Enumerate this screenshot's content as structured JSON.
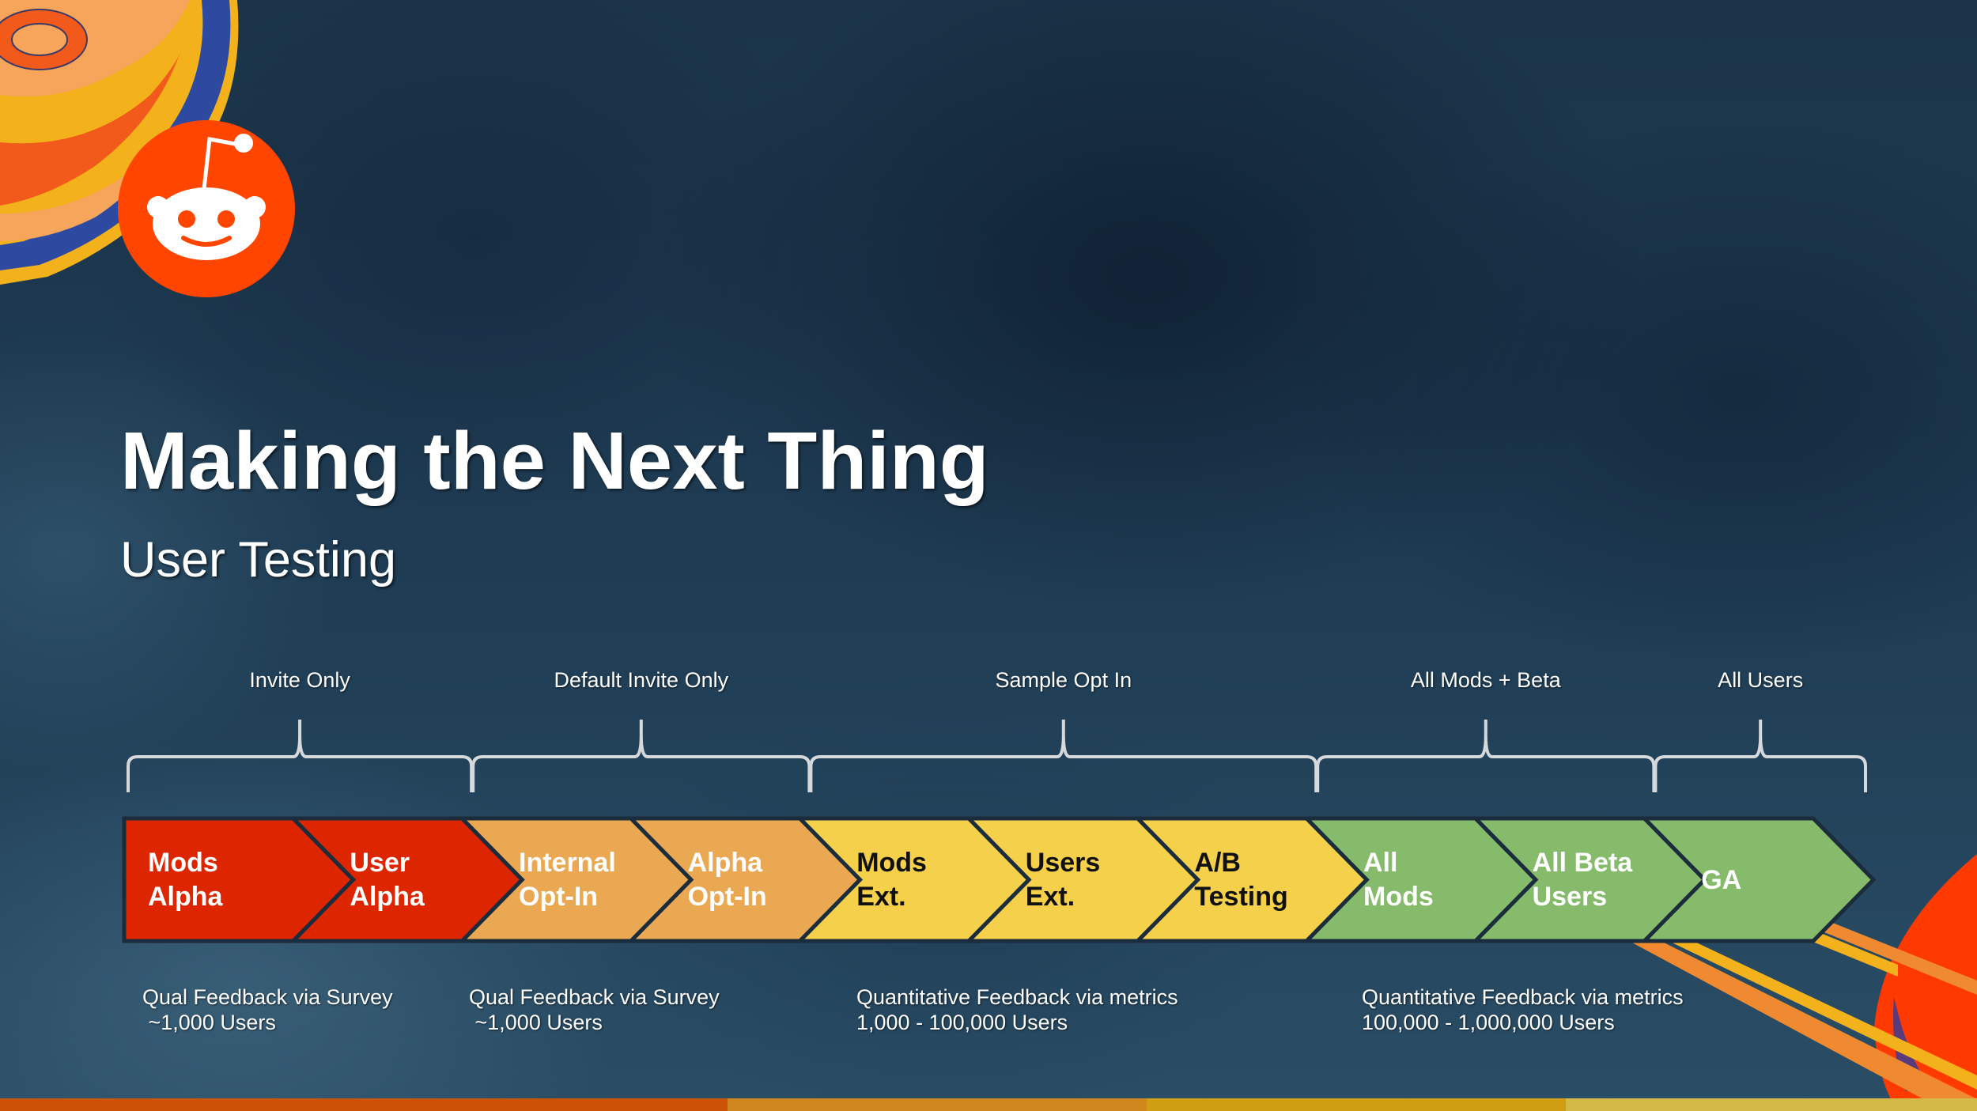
{
  "slide": {
    "title": "Making the Next Thing",
    "subtitle": "User Testing",
    "logo": "reddit-snoo-icon",
    "colors": {
      "logo": "#ff4500",
      "red": "#dd2500",
      "orange": "#eba852",
      "yellow": "#f5d04a",
      "green": "#85bb6b",
      "brace": "#d6d9dc"
    }
  },
  "groups": [
    {
      "label": "Invite Only",
      "stages": [
        0,
        1
      ]
    },
    {
      "label": "Default Invite Only",
      "stages": [
        2,
        3
      ]
    },
    {
      "label": "Sample Opt In",
      "stages": [
        4,
        5,
        6
      ]
    },
    {
      "label": "All Mods + Beta",
      "stages": [
        7,
        8
      ]
    },
    {
      "label": "All Users",
      "stages": [
        9
      ]
    }
  ],
  "stages": [
    {
      "label": "Mods\nAlpha",
      "color": "#dd2500",
      "text_color": "#ffffff"
    },
    {
      "label": "User\nAlpha",
      "color": "#dd2500",
      "text_color": "#ffffff"
    },
    {
      "label": "Internal\nOpt-In",
      "color": "#eba852",
      "text_color": "#ffffff"
    },
    {
      "label": "Alpha\nOpt-In",
      "color": "#eba852",
      "text_color": "#ffffff"
    },
    {
      "label": "Mods\nExt.",
      "color": "#f5d04a",
      "text_color": "#111111"
    },
    {
      "label": "Users\nExt.",
      "color": "#f5d04a",
      "text_color": "#111111"
    },
    {
      "label": "A/B\nTesting",
      "color": "#f5d04a",
      "text_color": "#111111"
    },
    {
      "label": "All\nMods",
      "color": "#85bb6b",
      "text_color": "#ffffff"
    },
    {
      "label": "All Beta\nUsers",
      "color": "#85bb6b",
      "text_color": "#ffffff"
    },
    {
      "label": "GA",
      "color": "#85bb6b",
      "text_color": "#ffffff"
    }
  ],
  "feedback": [
    {
      "text": "Qual Feedback via Survey\n ~1,000 Users"
    },
    {
      "text": "Qual Feedback via Survey\n ~1,000 Users"
    },
    {
      "text": "Quantitative Feedback via metrics\n1,000 - 100,000 Users"
    },
    {
      "text": "Quantitative Feedback via metrics\n100,000 - 1,000,000 Users"
    }
  ],
  "footer_bar_colors": [
    "#cc5208",
    "#cf861d",
    "#cf9e12",
    "#d3b945"
  ]
}
